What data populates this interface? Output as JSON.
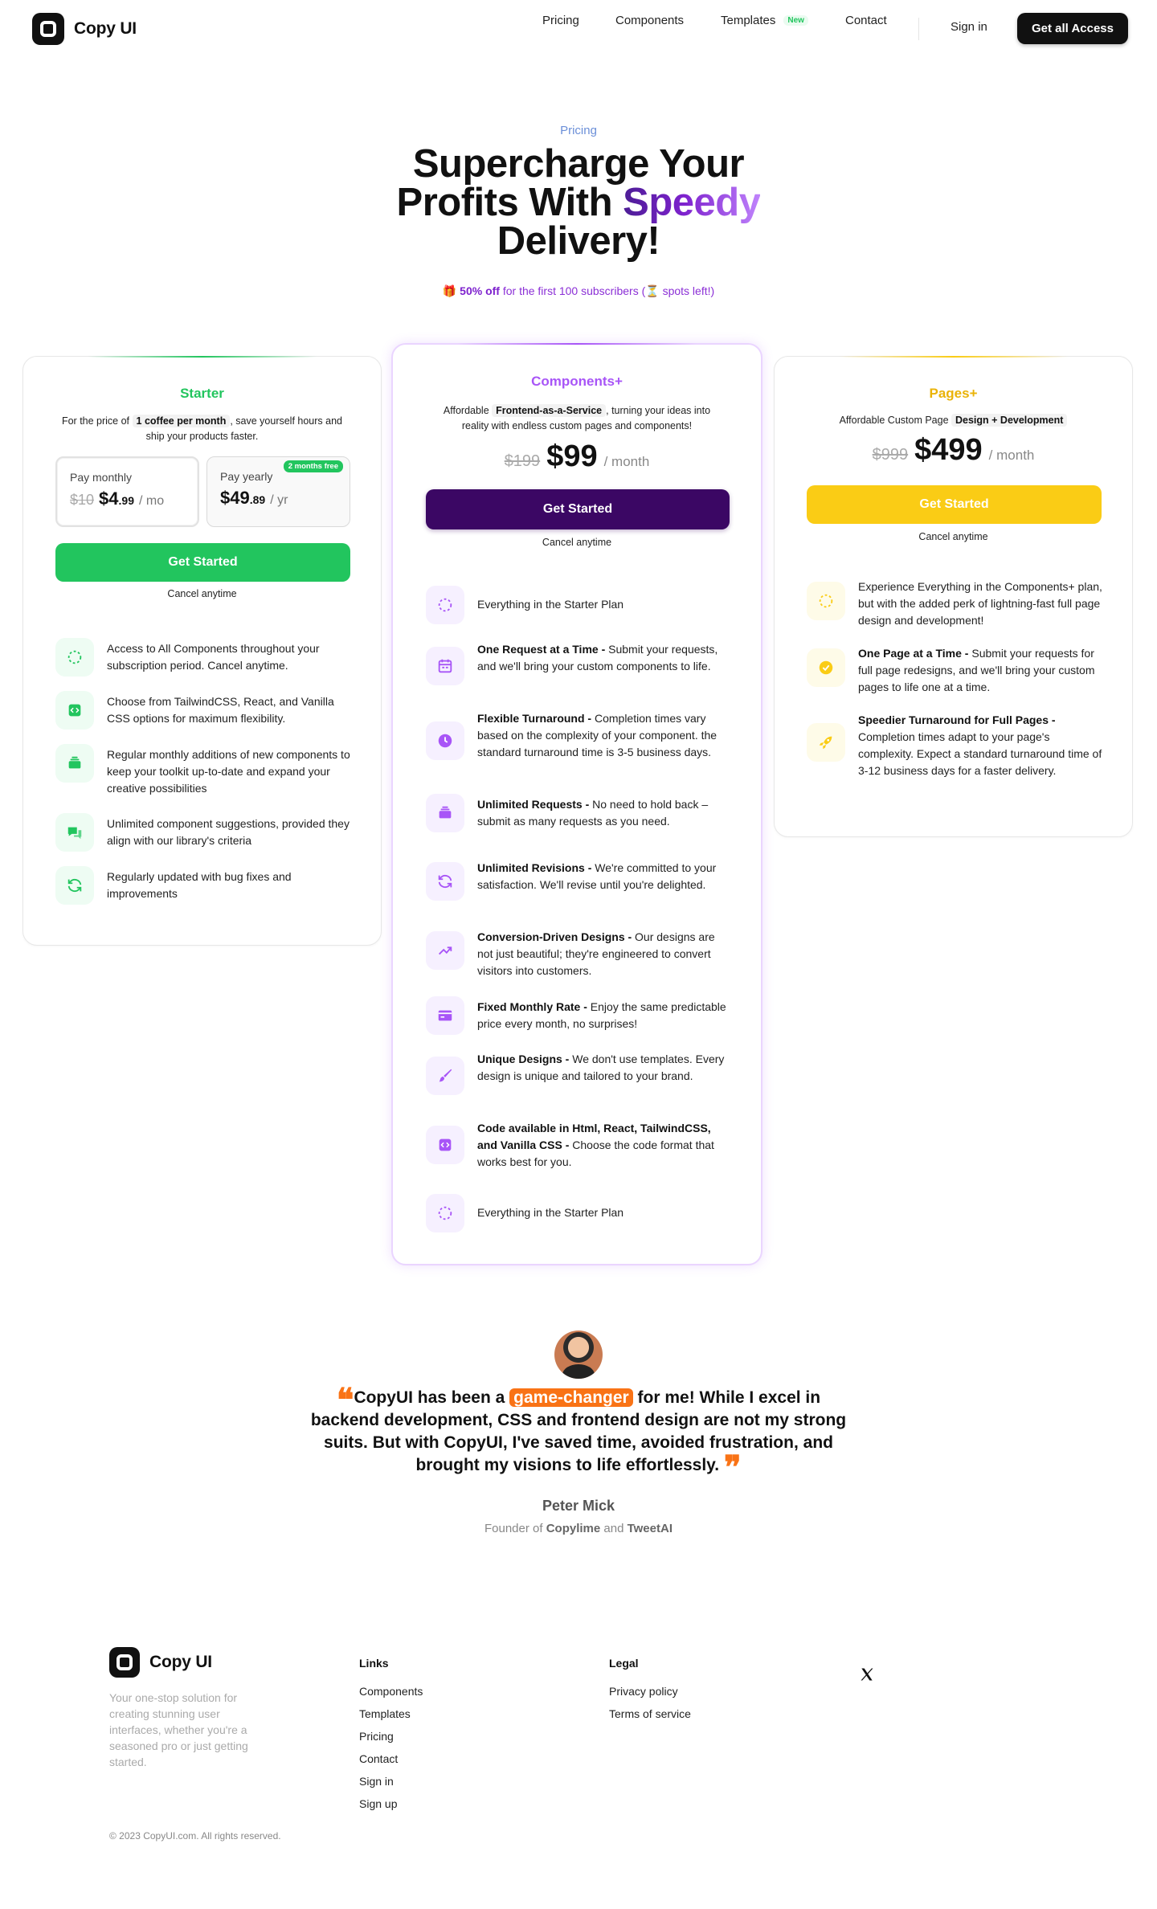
{
  "brand": {
    "name": "Copy UI"
  },
  "nav": {
    "pricing": "Pricing",
    "components": "Components",
    "templates": "Templates",
    "templates_badge": "New",
    "contact": "Contact",
    "signin": "Sign in",
    "cta": "Get all Access"
  },
  "hero": {
    "eyebrow": "Pricing",
    "title_line1": "Supercharge Your",
    "title_line2_a": "Profits With ",
    "title_accent": "Speedy",
    "title_line3": "Delivery!",
    "promo_gift": "🎁",
    "promo_bold": "50% off",
    "promo_text": " for the first 100 subscribers (",
    "promo_spots": "⏳",
    "promo_end": " spots left!)"
  },
  "starter": {
    "name": "Starter",
    "desc_pre": "For the price of ",
    "desc_pill": "1 coffee per month",
    "desc_post": ", save yourself hours and ship your products faster.",
    "monthly_label": "Pay monthly",
    "monthly_old": "$10",
    "monthly_price": "$4",
    "monthly_cents": ".99",
    "monthly_per": "/ mo",
    "yearly_label": "Pay yearly",
    "yearly_badge": "2 months free",
    "yearly_price": "$49",
    "yearly_cents": ".89",
    "yearly_per": "/ yr",
    "cta": "Get Started",
    "cancel": "Cancel anytime",
    "features": [
      {
        "icon": "dashed-circle-icon",
        "text": "Access to All Components throughout your subscription period. Cancel anytime."
      },
      {
        "icon": "code-icon",
        "text": "Choose from TailwindCSS, React, and Vanilla CSS options for maximum flexibility."
      },
      {
        "icon": "stack-icon",
        "text": "Regular monthly additions of new components to keep your toolkit up-to-date and expand your creative possibilities"
      },
      {
        "icon": "chat-icon",
        "text": "Unlimited component suggestions, provided they align with our library's criteria"
      },
      {
        "icon": "refresh-icon",
        "text": "Regularly updated with bug fixes and improvements"
      }
    ]
  },
  "components": {
    "name": "Components+",
    "desc_pre": "Affordable ",
    "desc_pill": "Frontend-as-a-Service",
    "desc_post": ", turning your ideas into reality with endless custom pages and components!",
    "old_price": "$199",
    "price": "$99",
    "per": "/ month",
    "cta": "Get Started",
    "cancel": "Cancel anytime",
    "features": [
      {
        "icon": "dashed-circle-icon",
        "title": "",
        "text": "Everything in the Starter Plan"
      },
      {
        "icon": "calendar-icon",
        "title": "One Request at a Time - ",
        "text": "Submit your requests, and we'll bring your custom components to life."
      },
      {
        "icon": "clock-icon",
        "title": "Flexible Turnaround - ",
        "text": "Completion times vary based on the complexity of your component. the standard turnaround time is 3-5 business days."
      },
      {
        "icon": "stack-icon",
        "title": "Unlimited Requests - ",
        "text": "No need to hold back – submit as many requests as you need."
      },
      {
        "icon": "refresh-icon",
        "title": "Unlimited Revisions - ",
        "text": "We're committed to your satisfaction. We'll revise until you're delighted."
      },
      {
        "icon": "trend-up-icon",
        "title": "Conversion-Driven Designs - ",
        "text": "Our designs are not just beautiful; they're engineered to convert visitors into customers."
      },
      {
        "icon": "credit-card-icon",
        "title": "Fixed Monthly Rate - ",
        "text": "Enjoy the same predictable price every month, no surprises!"
      },
      {
        "icon": "brush-icon",
        "title": "Unique Designs - ",
        "text": "We don't use templates. Every design is unique and tailored to your brand."
      },
      {
        "icon": "code-icon",
        "title": "Code available in Html, React, TailwindCSS, and Vanilla CSS - ",
        "text": "Choose the code format that works best for you."
      },
      {
        "icon": "dashed-circle-icon",
        "title": "",
        "text": "Everything in the Starter Plan"
      }
    ]
  },
  "pages": {
    "name": "Pages+",
    "desc_pre": "Affordable Custom Page ",
    "desc_pill": "Design + Development",
    "old_price": "$999",
    "price": "$499",
    "per": "/ month",
    "cta": "Get Started",
    "cancel": "Cancel anytime",
    "features": [
      {
        "icon": "dashed-circle-icon",
        "title": "",
        "text": "Experience Everything in the Components+ plan, but with the added perk of lightning-fast full page design and development!"
      },
      {
        "icon": "check-circle-icon",
        "title": "One Page at a Time - ",
        "text": "Submit your requests for full page redesigns, and we'll bring your custom pages to life one at a time."
      },
      {
        "icon": "rocket-icon",
        "title": "Speedier Turnaround for Full Pages - ",
        "text": "Completion times adapt to your page's complexity. Expect a standard turnaround time of 3-12 business days for a faster delivery."
      }
    ]
  },
  "testimonial": {
    "quote_pre": "CopyUI has been a ",
    "quote_highlight": "game-changer",
    "quote_post": " for me! While I excel in backend development, CSS and frontend design are not my strong suits. But with CopyUI, I've saved time, avoided frustration, and brought my visions to life effortlessly.",
    "author": "Peter Mick",
    "role_pre": "Founder of ",
    "role_company1": "Copylime",
    "role_and": " and ",
    "role_company2": "TweetAI"
  },
  "footer": {
    "brand": "Copy UI",
    "desc": "Your one-stop solution for creating stunning user interfaces, whether you're a seasoned pro or just getting started.",
    "links_title": "Links",
    "links": [
      "Components",
      "Templates",
      "Pricing",
      "Contact",
      "Sign in",
      "Sign up"
    ],
    "legal_title": "Legal",
    "legal": [
      "Privacy policy",
      "Terms of service"
    ],
    "copyright": "© 2023 CopyUI.com. All rights reserved."
  },
  "colors": {
    "starter": "#22c55e",
    "components": "#a855f7",
    "components_button": "#3b0764",
    "pages": "#facc15",
    "highlight": "#f97316"
  }
}
